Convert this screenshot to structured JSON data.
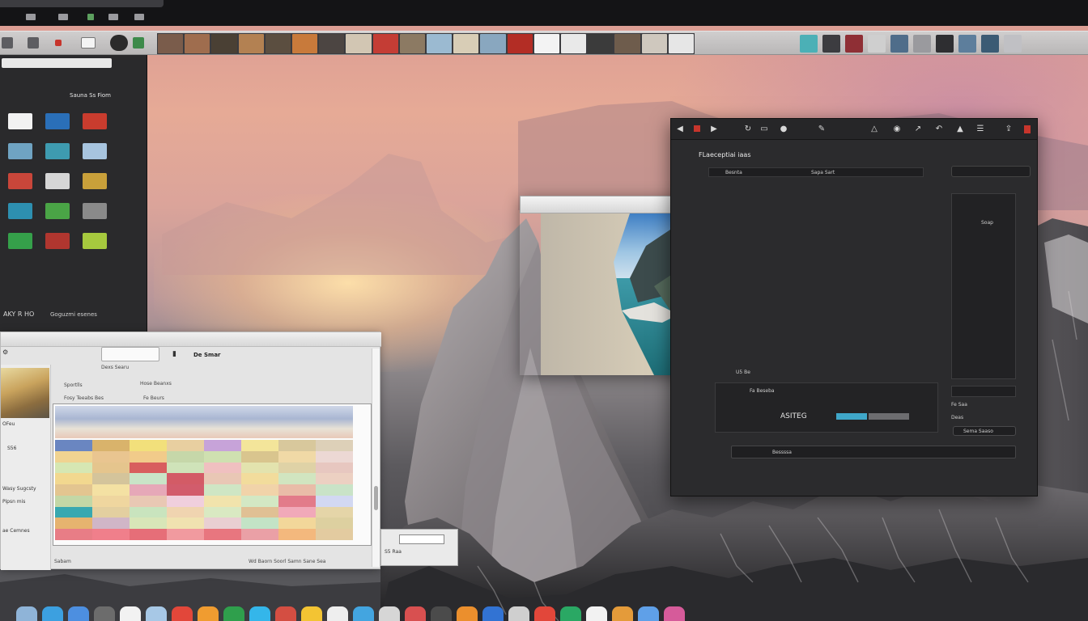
{
  "library": {
    "header_left": "",
    "header_right": "",
    "section_title": "Sauna Ss Fiom",
    "footer_left": "AKY R HO",
    "footer_right": "Goguzmi esenes",
    "items": [
      {
        "color": "#f2f2f2",
        "label": ""
      },
      {
        "color": "#2a6fb8",
        "label": ""
      },
      {
        "color": "#c93c2e",
        "label": ""
      },
      {
        "color": "#6fa3c2",
        "label": ""
      },
      {
        "color": "#3e9bb0",
        "label": ""
      },
      {
        "color": "#a7c4df",
        "label": ""
      },
      {
        "color": "#c9463a",
        "label": ""
      },
      {
        "color": "#d6d6d6",
        "label": ""
      },
      {
        "color": "#c9a03a",
        "label": ""
      },
      {
        "color": "#2d8fb0",
        "label": ""
      },
      {
        "color": "#4aa446",
        "label": ""
      },
      {
        "color": "#8a8a8a",
        "label": ""
      },
      {
        "color": "#35a04a",
        "label": ""
      },
      {
        "color": "#b0362f",
        "label": ""
      },
      {
        "color": "#a6c93e",
        "label": ""
      }
    ]
  },
  "light_window": {
    "header_label": "De Smar",
    "button_label": "Dexs Searu",
    "label_a": "Sportlls",
    "label_b": "Hose Beanxs",
    "row_label": "Fosy Teeabs Bes",
    "row_label_2": "Fe Beurs",
    "sidebar_labels": [
      "OFeu",
      "S56",
      "Wasy Sugcsty",
      "Pipsn mis",
      "ae Cemnes"
    ],
    "footer_left": "Sabam",
    "footer_right": "Wd Baorn Soorl Samn Sane Sea",
    "popup_label": "S5 Raa",
    "hero_cells": [
      "#6a86c1",
      "#d9b36b",
      "#f2e07b",
      "#e8cfa0",
      "#c7a3d9",
      "#f3e59a",
      "#d8c89c",
      "#ddd0b8",
      "#f0d391",
      "#e9c590",
      "#f1cb8a",
      "#c6d7a9",
      "#cfe0b0",
      "#d9c58e",
      "#f0d9a6",
      "#ecd8d4",
      "#d6e7b3",
      "#e5c58d",
      "#d85e5e",
      "#cfe3b9",
      "#f0c0c0",
      "#e3e3ae",
      "#dfd2a6",
      "#e7c7c0",
      "#f2d88f",
      "#d4c49b",
      "#c9e4c7",
      "#d35b66",
      "#e9c7b5",
      "#f2dc9c",
      "#d1e5c0",
      "#ecd0c2",
      "#e3c590",
      "#f4e1a3",
      "#e6a8b8",
      "#d25c6c",
      "#cfe6c4",
      "#f1d3a9",
      "#e9bca8",
      "#c9e3c7",
      "#c3d7a6",
      "#efd69f",
      "#e9c8b4",
      "#f0cfdd",
      "#f1e3ac",
      "#d3e8c4",
      "#e27b8a",
      "#d2d8f2",
      "#38a8b0",
      "#e3cfa0",
      "#c9e4be",
      "#f0d4b0",
      "#d9e9c2",
      "#e0c094",
      "#f1a9b9",
      "#e5d5a8",
      "#e6b36f",
      "#d0b6c7",
      "#d8e6b8",
      "#f0e2b0",
      "#e9cfd2",
      "#c3e3c6",
      "#f2d79a",
      "#ddd0a0",
      "#e87d86",
      "#f07f8b",
      "#e66e78",
      "#f19a9f",
      "#e8767f",
      "#eaa0a6",
      "#f3b87d",
      "#e3cba0"
    ]
  },
  "editor": {
    "title": "FLaeceptiai iaas",
    "path_label": "Besnta",
    "path_label_2": "Sapa Sart",
    "right_label": "Soap",
    "stats_label": "U5 Be",
    "panel_label": "Fa Beseba",
    "slider_text": "ASITEG",
    "slider_value": 0.42,
    "side_label": "Fe Saa",
    "side_label_2": "Deas",
    "select_label": "Sema Saaso",
    "bottom_label": "Bessssa"
  },
  "dock": {
    "colors": [
      "#8fb4d8",
      "#3ca0e0",
      "#4d8fe0",
      "#6c6c6c",
      "#f2f2f2",
      "#a7c8e6",
      "#e2473a",
      "#f09c30",
      "#2f9f4c",
      "#34b6ea",
      "#d44e42",
      "#f3c433",
      "#eeeeee",
      "#43a5e0",
      "#d6d6d6",
      "#d85050",
      "#4b4b4b",
      "#eb8f2d",
      "#3273d3",
      "#cfcfcf",
      "#e2473a",
      "#2aa864",
      "#f2f2f2",
      "#e49b3a",
      "#5fa0e8",
      "#d65b9a"
    ]
  }
}
